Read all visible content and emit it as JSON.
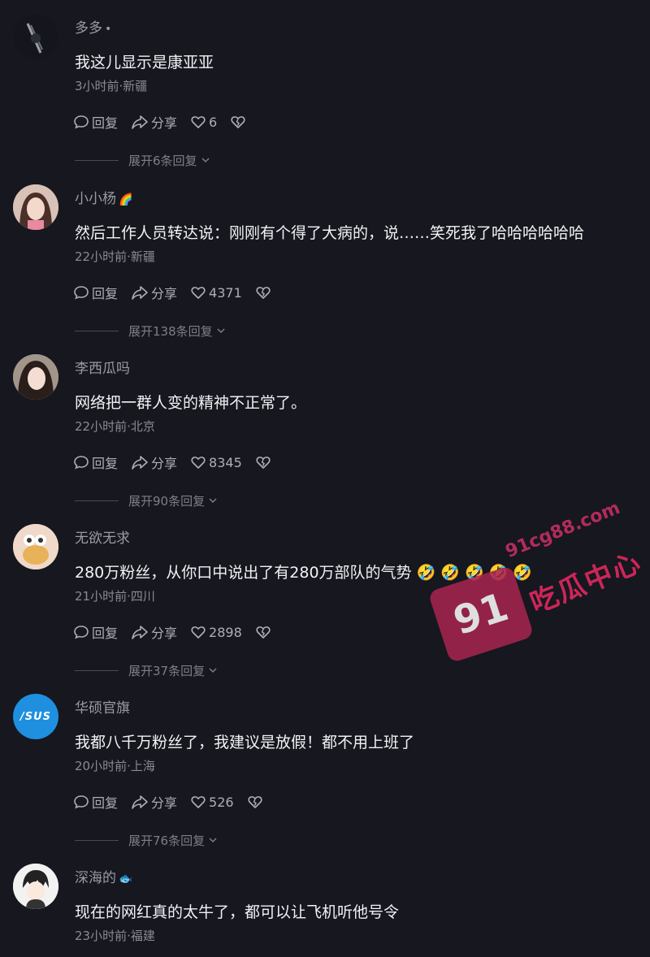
{
  "actions": {
    "reply": "回复",
    "share": "分享"
  },
  "comments": [
    {
      "username": "多多",
      "badge": "•",
      "text": "我这儿显示是康亚亚",
      "meta": "3小时前·新疆",
      "likes": "6",
      "expand": "展开6条回复"
    },
    {
      "username": "小小杨",
      "badge": "🌈",
      "text": "然后工作人员转达说：刚刚有个得了大病的，说……笑死我了哈哈哈哈哈哈",
      "meta": "22小时前·新疆",
      "likes": "4371",
      "expand": "展开138条回复"
    },
    {
      "username": "李西瓜吗",
      "badge": "",
      "text": "网络把一群人变的精神不正常了。",
      "meta": "22小时前·北京",
      "likes": "8345",
      "expand": "展开90条回复"
    },
    {
      "username": "无欲无求",
      "badge": "",
      "text": "280万粉丝，从你口中说出了有280万部队的气势 🤣 🤣 🤣 🤣 🤣",
      "meta": "21小时前·四川",
      "likes": "2898",
      "expand": "展开37条回复"
    },
    {
      "username": "华硕官旗",
      "badge": "",
      "avatar_text": "/SUS",
      "text": "我都八千万粉丝了，我建议是放假！都不用上班了",
      "meta": "20小时前·上海",
      "likes": "526",
      "expand": "展开76条回复"
    },
    {
      "username": "深海的",
      "badge": "🐟",
      "text": "现在的网红真的太牛了，都可以让飞机听他号令",
      "meta": "23小时前·福建",
      "likes": "",
      "expand": ""
    }
  ],
  "watermark": {
    "number": "91",
    "url": "91cg88.com",
    "name": "吃瓜中心"
  }
}
